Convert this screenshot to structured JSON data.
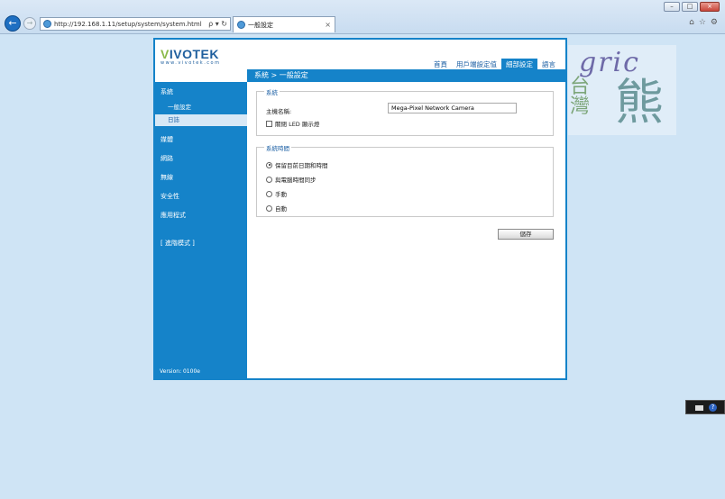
{
  "browser": {
    "url": "http://192.168.1.11/setup/system/system.html",
    "url_controls": "ρ ▾ ↻",
    "tab_title": "一般設定",
    "tab_close": "×",
    "window_buttons": {
      "minimize": "–",
      "maximize": "□",
      "close": "×"
    },
    "back_glyph": "←",
    "forward_glyph": "→",
    "right_icons": {
      "home": "⌂",
      "favorites": "☆",
      "tools": "⚙"
    }
  },
  "camera": {
    "brand_prefix": "V",
    "brand_rest": "IVOTEK",
    "brand_site": "www.vivotek.com",
    "top_nav": [
      {
        "label": "首頁",
        "active": false
      },
      {
        "label": "用戶端設定值",
        "active": false
      },
      {
        "label": "細部設定",
        "active": true
      },
      {
        "label": "語言",
        "active": false
      }
    ],
    "breadcrumb": "系統  >  一般設定",
    "sidebar": {
      "system": "系統",
      "general_settings": "一般設定",
      "logs": "日誌",
      "media": "媒體",
      "network": "網路",
      "wireless": "無線",
      "security": "安全性",
      "applications": "應用程式",
      "advanced_mode": "[ 進階模式 ]",
      "version": "Version: 0100e"
    },
    "system_section": {
      "legend": "系統",
      "host_label": "主機名稱:",
      "host_value": "Mega-Pixel Network Camera",
      "led_label": "關閉 LED 顯示燈",
      "led_checked": false
    },
    "time_section": {
      "legend": "系統時間",
      "options": [
        {
          "label": "保留目前日期和時間",
          "selected": true
        },
        {
          "label": "與電腦時間同步",
          "selected": false
        },
        {
          "label": "手動",
          "selected": false
        },
        {
          "label": "自動",
          "selected": false
        }
      ]
    },
    "save_label": "儲存"
  },
  "watermark": {
    "latin": "gric",
    "cjk_small": "台灣",
    "cjk_big": "熊"
  },
  "tray": {
    "help_glyph": "?"
  },
  "colors": {
    "accent": "#1583c9",
    "link": "#1a5ea3",
    "logo_green": "#8ab94a"
  }
}
